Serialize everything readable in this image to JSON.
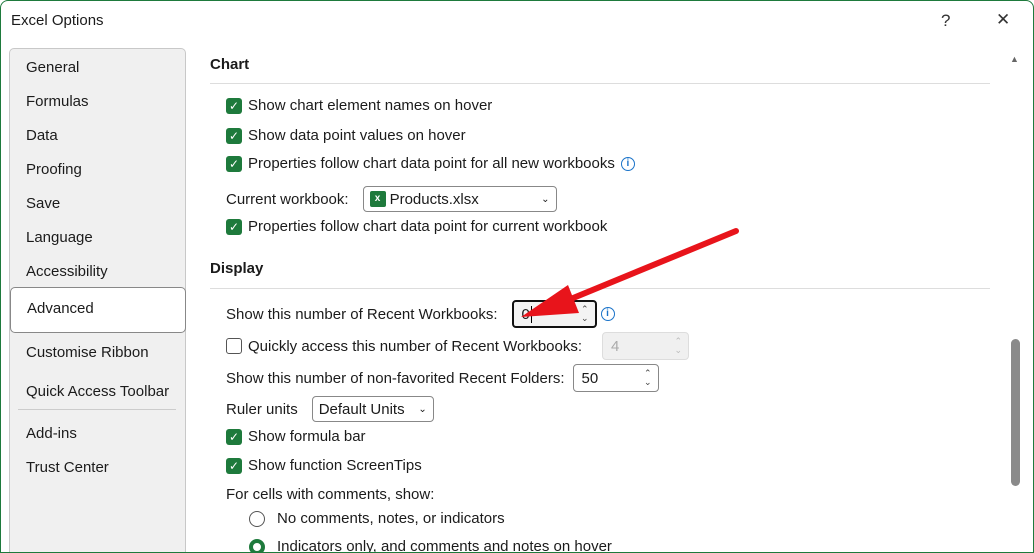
{
  "window": {
    "title": "Excel Options",
    "help": "?",
    "close": "✕"
  },
  "sidebar": {
    "items": [
      "General",
      "Formulas",
      "Data",
      "Proofing",
      "Save",
      "Language",
      "Accessibility",
      "Advanced",
      "Customise Ribbon",
      "Quick Access Toolbar",
      "Add-ins",
      "Trust Center"
    ],
    "selected": "Advanced"
  },
  "chart": {
    "heading": "Chart",
    "opt1": "Show chart element names on hover",
    "opt2": "Show data point values on hover",
    "opt3": "Properties follow chart data point for all new workbooks",
    "current_label": "Current workbook:",
    "current_value": "Products.xlsx",
    "opt4": "Properties follow chart data point for current workbook"
  },
  "display": {
    "heading": "Display",
    "recent_label": "Show this number of Recent Workbooks:",
    "recent_value": "0",
    "quick_label": "Quickly access this number of Recent Workbooks:",
    "quick_value": "4",
    "folders_label": "Show this number of non-favorited Recent Folders:",
    "folders_value": "50",
    "ruler_label": "Ruler units",
    "ruler_value": "Default Units",
    "formula_bar": "Show formula bar",
    "screentips": "Show function ScreenTips",
    "comments_label": "For cells with comments, show:",
    "radio1": "No comments, notes, or indicators",
    "radio2": "Indicators only, and comments and notes on hover"
  },
  "colors": {
    "accent": "#1e7a3c",
    "arrow": "#e8141b"
  }
}
